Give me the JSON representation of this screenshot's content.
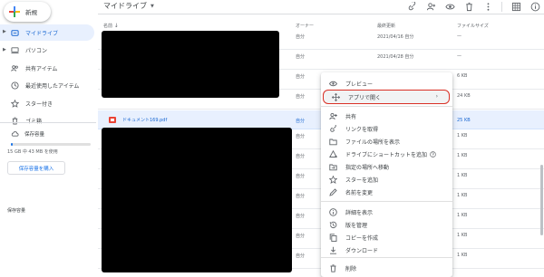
{
  "sidebar": {
    "new_label": "新規",
    "items": [
      {
        "label": "マイドライブ",
        "icon": "drive-folder-icon",
        "active": true
      },
      {
        "label": "パソコン",
        "icon": "computer-icon",
        "active": false
      },
      {
        "label": "共有アイテム",
        "icon": "shared-people-icon",
        "active": false
      },
      {
        "label": "最近使用したアイテム",
        "icon": "clock-icon",
        "active": false
      },
      {
        "label": "スター付き",
        "icon": "star-icon",
        "active": false
      },
      {
        "label": "ゴミ箱",
        "icon": "trash-icon",
        "active": false
      }
    ],
    "storage_label": "保存容量",
    "storage_usage": "15 GB 中 43 MB を使用",
    "storage_used_fraction": 0.003,
    "buy_storage_label": "保存容量を購入",
    "bottom_label": "保存容量"
  },
  "header": {
    "title": "マイドライブ",
    "icons": [
      "link-icon",
      "add-person-icon",
      "preview-eye-icon",
      "delete-icon",
      "more-icon",
      "grid-view-icon",
      "info-icon"
    ]
  },
  "columns": {
    "name": "名前",
    "owner": "オーナー",
    "modified": "最終更新",
    "size": "ファイルサイズ"
  },
  "rows": [
    {
      "name": "",
      "owner": "自分",
      "modified": "2021/04/16 自分",
      "size": "—"
    },
    {
      "name": "",
      "owner": "自分",
      "modified": "2021/04/28 自分",
      "size": "—"
    },
    {
      "name": "",
      "owner": "自分",
      "modified": "",
      "size": "6 KB"
    },
    {
      "name": "",
      "owner": "自分",
      "modified": "",
      "size": "24 KB"
    },
    {
      "name": "ドキュメント169.pdf",
      "owner": "自分",
      "modified": "",
      "size": "25 KB",
      "selected": true
    },
    {
      "name": "",
      "owner": "自分",
      "modified": "",
      "size": "1 KB"
    },
    {
      "name": "",
      "owner": "自分",
      "modified": "",
      "size": "1 KB"
    },
    {
      "name": "",
      "owner": "自分",
      "modified": "",
      "size": "1 KB"
    },
    {
      "name": "",
      "owner": "自分",
      "modified": "",
      "size": "1 KB"
    },
    {
      "name": "",
      "owner": "自分",
      "modified": "",
      "size": "1 KB"
    },
    {
      "name": "",
      "owner": "自分",
      "modified": "",
      "size": "1 KB"
    },
    {
      "name": "",
      "owner": "自分",
      "modified": "",
      "size": "1 KB"
    }
  ],
  "context_menu": {
    "items": [
      {
        "label": "プレビュー",
        "icon": "eye-icon"
      },
      {
        "label": "アプリで開く",
        "icon": "move-arrows-icon",
        "submenu": true,
        "highlighted": true
      },
      {
        "label": "共有",
        "icon": "add-person-icon"
      },
      {
        "label": "リンクを取得",
        "icon": "link-icon"
      },
      {
        "label": "ファイルの場所を表示",
        "icon": "folder-icon"
      },
      {
        "label": "ドライブにショートカットを追加",
        "icon": "drive-shortcut-icon",
        "help": true
      },
      {
        "label": "指定の場所へ移動",
        "icon": "move-to-icon"
      },
      {
        "label": "スターを追加",
        "icon": "star-icon"
      },
      {
        "label": "名前を変更",
        "icon": "pencil-icon"
      },
      {
        "label": "詳細を表示",
        "icon": "info-icon"
      },
      {
        "label": "版を管理",
        "icon": "history-icon"
      },
      {
        "label": "コピーを作成",
        "icon": "copy-icon"
      },
      {
        "label": "ダウンロード",
        "icon": "download-icon"
      },
      {
        "label": "削除",
        "icon": "delete-icon"
      }
    ]
  },
  "colors": {
    "accent": "#1a73e8",
    "active_bg": "#e8f0fe",
    "highlight_border": "#d93025"
  }
}
